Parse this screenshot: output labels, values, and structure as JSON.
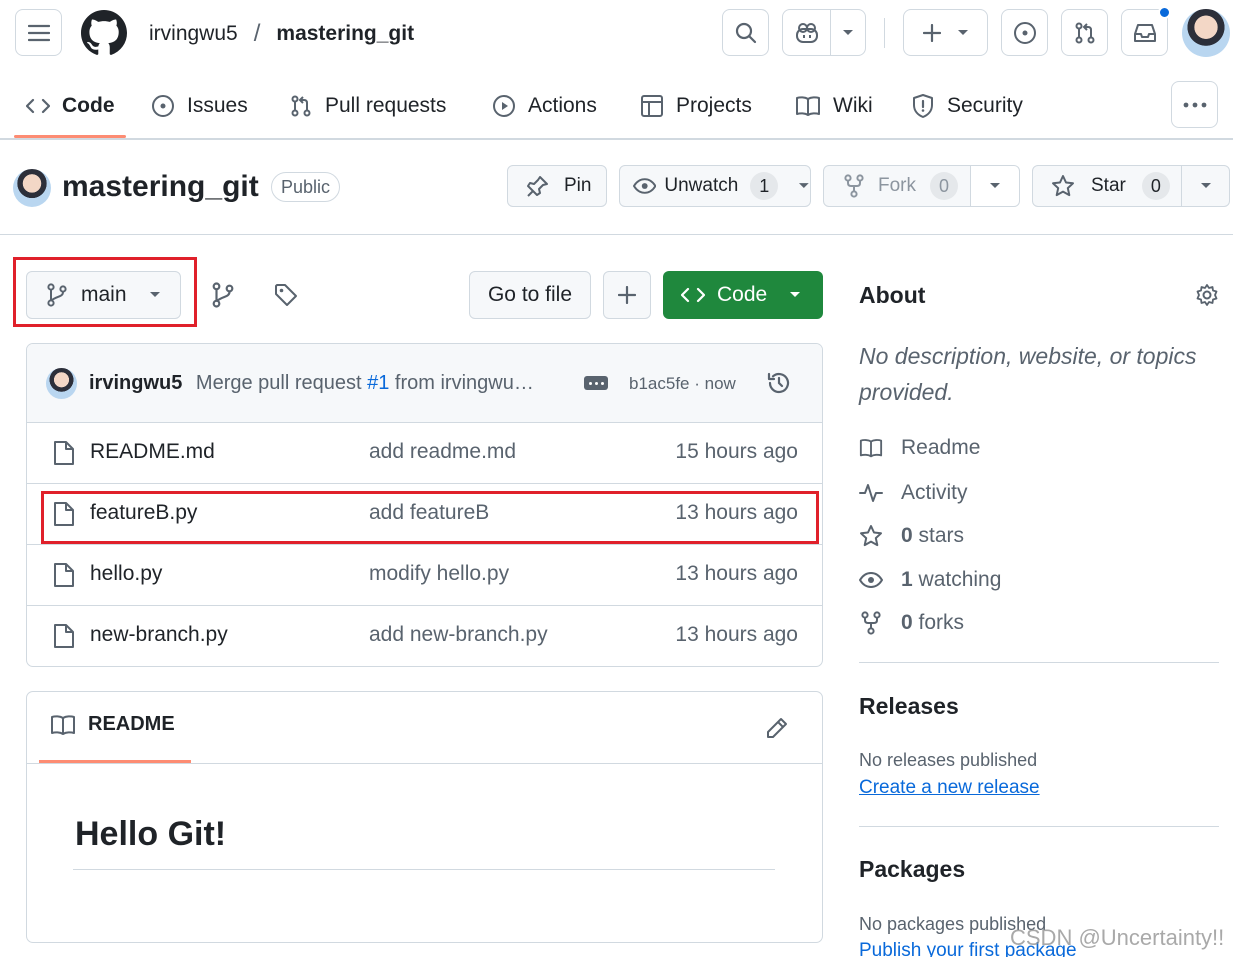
{
  "header": {
    "owner": "irvingwu5",
    "separator": "/",
    "repo": "mastering_git"
  },
  "nav": {
    "tabs": [
      {
        "label": "Code",
        "icon": "code-icon"
      },
      {
        "label": "Issues",
        "icon": "issue-icon"
      },
      {
        "label": "Pull requests",
        "icon": "pull-request-icon"
      },
      {
        "label": "Actions",
        "icon": "play-icon"
      },
      {
        "label": "Projects",
        "icon": "table-icon"
      },
      {
        "label": "Wiki",
        "icon": "book-icon"
      },
      {
        "label": "Security",
        "icon": "shield-icon"
      }
    ],
    "active_tab": "Code"
  },
  "repo": {
    "name": "mastering_git",
    "visibility": "Public",
    "pin_label": "Pin",
    "unwatch_label": "Unwatch",
    "watch_count": "1",
    "fork_label": "Fork",
    "fork_count": "0",
    "star_label": "Star",
    "star_count": "0"
  },
  "toolbar": {
    "branch": "main",
    "go_to_file": "Go to file",
    "add_label": "+",
    "code_label": "Code"
  },
  "commit": {
    "author": "irvingwu5",
    "message_prefix": "Merge pull request ",
    "pr_link": "#1",
    "message_suffix": " from irvingwu…",
    "sha": "b1ac5fe",
    "dot": "·",
    "time": "now"
  },
  "files": [
    {
      "name": "README.md",
      "message": "add readme.md",
      "time": "15 hours ago"
    },
    {
      "name": "featureB.py",
      "message": "add featureB",
      "time": "13 hours ago"
    },
    {
      "name": "hello.py",
      "message": "modify hello.py",
      "time": "13 hours ago"
    },
    {
      "name": "new-branch.py",
      "message": "add new-branch.py",
      "time": "13 hours ago"
    }
  ],
  "readme": {
    "tab_label": "README",
    "heading": "Hello Git!"
  },
  "about": {
    "title": "About",
    "description": "No description, website, or topics provided.",
    "readme": "Readme",
    "activity": "Activity",
    "stars_count": "0",
    "stars_label": "stars",
    "watching_count": "1",
    "watching_label": "watching",
    "forks_count": "0",
    "forks_label": "forks"
  },
  "releases": {
    "title": "Releases",
    "empty": "No releases published",
    "create_link": "Create a new release"
  },
  "packages": {
    "title": "Packages",
    "empty": "No packages published",
    "publish_link": "Publish your first package"
  },
  "watermark": "CSDN @Uncertainty!!",
  "colors": {
    "accent_green": "#1f883d",
    "link_blue": "#0969da",
    "highlight_red": "#e0202a",
    "tab_underline": "#fd8c73",
    "notification_dot": "#0969da"
  }
}
